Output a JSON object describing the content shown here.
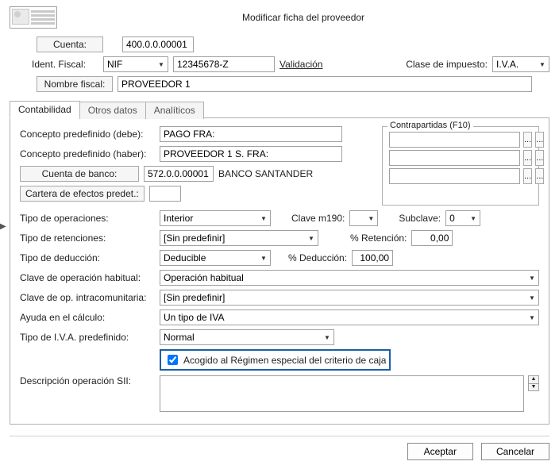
{
  "title": "Modificar ficha del proveedor",
  "header": {
    "cuenta_label": "Cuenta:",
    "cuenta_value": "400.0.0.00001",
    "ident_fiscal_label": "Ident. Fiscal:",
    "ident_tipo": "NIF",
    "ident_num": "12345678-Z",
    "validacion": "Validación",
    "clase_impuesto_label": "Clase de impuesto:",
    "clase_impuesto_value": "I.V.A.",
    "nombre_fiscal_label": "Nombre fiscal:",
    "nombre_fiscal_value": "PROVEEDOR 1"
  },
  "tabs": {
    "contabilidad": "Contabilidad",
    "otros_datos": "Otros datos",
    "analiticos": "Analíticos"
  },
  "contab": {
    "concepto_debe_label": "Concepto predefinido (debe):",
    "concepto_debe_value": "PAGO FRA:",
    "concepto_haber_label": "Concepto predefinido (haber):",
    "concepto_haber_value": "PROVEEDOR 1 S. FRA:",
    "cuenta_banco_btn": "Cuenta de banco:",
    "cuenta_banco_code": "572.0.0.00001",
    "cuenta_banco_name": "BANCO SANTANDER",
    "cartera_btn": "Cartera de efectos predet.:",
    "contrapartidas_legend": "Contrapartidas (F10)",
    "ellipsis": "...",
    "tipo_op_label": "Tipo de operaciones:",
    "tipo_op_value": "Interior",
    "clave_m190_label": "Clave m190:",
    "subclave_label": "Subclave:",
    "subclave_value": "0",
    "tipo_ret_label": "Tipo de retenciones:",
    "tipo_ret_value": "[Sin predefinir]",
    "pct_ret_label": "% Retención:",
    "pct_ret_value": "0,00",
    "tipo_ded_label": "Tipo de deducción:",
    "tipo_ded_value": "Deducible",
    "pct_ded_label": "% Deducción:",
    "pct_ded_value": "100,00",
    "clave_op_hab_label": "Clave de operación habitual:",
    "clave_op_hab_value": "Operación habitual",
    "clave_intra_label": "Clave de op. intracomunitaria:",
    "clave_intra_value": "[Sin predefinir]",
    "ayuda_label": "Ayuda en el cálculo:",
    "ayuda_value": "Un tipo de IVA",
    "tipo_iva_label": "Tipo de I.V.A. predefinido:",
    "tipo_iva_value": "Normal",
    "recc_label": "Acogido al Régimen especial del criterio de caja",
    "recc_checked": true,
    "desc_sii_label": "Descripción operación SII:",
    "desc_sii_value": ""
  },
  "footer": {
    "aceptar": "Aceptar",
    "cancelar": "Cancelar"
  }
}
